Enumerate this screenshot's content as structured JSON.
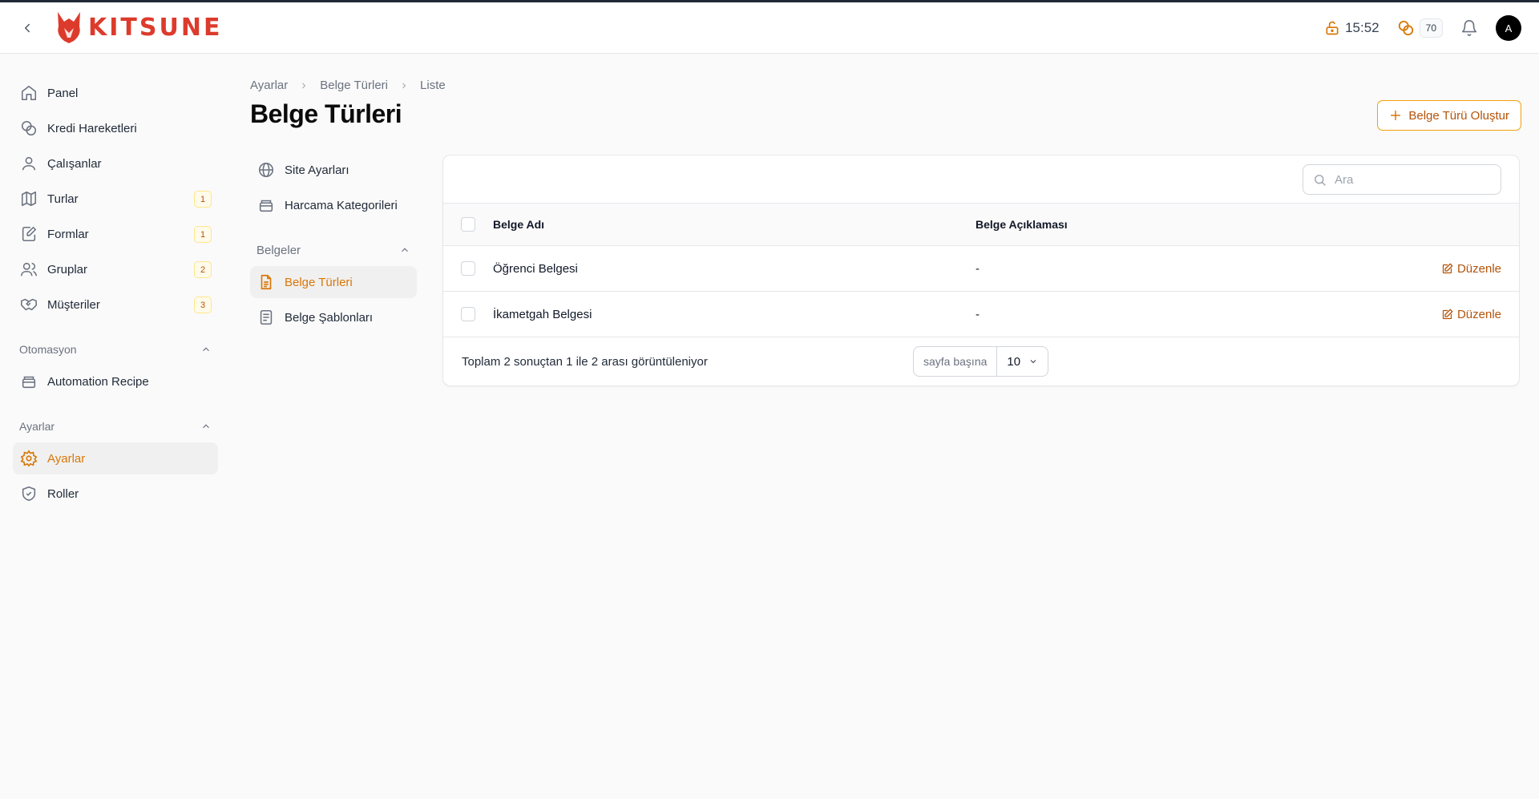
{
  "header": {
    "logo_text": "KITSUNE",
    "time": "15:52",
    "credits": "70",
    "avatar_initial": "A",
    "brand_color": "#dc3b2c",
    "accent_color": "#d97706"
  },
  "sidebar": {
    "items": [
      {
        "label": "Panel",
        "icon": "home-icon"
      },
      {
        "label": "Kredi Hareketleri",
        "icon": "coins-icon"
      },
      {
        "label": "Çalışanlar",
        "icon": "user-icon"
      },
      {
        "label": "Turlar",
        "icon": "map-icon",
        "badge": "1"
      },
      {
        "label": "Formlar",
        "icon": "form-edit-icon",
        "badge": "1"
      },
      {
        "label": "Gruplar",
        "icon": "users-icon",
        "badge": "2"
      },
      {
        "label": "Müşteriler",
        "icon": "handshake-icon",
        "badge": "3"
      }
    ],
    "groups": [
      {
        "label": "Otomasyon",
        "items": [
          {
            "label": "Automation Recipe",
            "icon": "archive-icon"
          }
        ]
      },
      {
        "label": "Ayarlar",
        "items": [
          {
            "label": "Ayarlar",
            "icon": "gear-icon",
            "active": true
          },
          {
            "label": "Roller",
            "icon": "shield-check-icon"
          }
        ]
      }
    ]
  },
  "breadcrumb": [
    "Ayarlar",
    "Belge Türleri",
    "Liste"
  ],
  "page_title": "Belge Türleri",
  "create_button": "Belge Türü Oluştur",
  "subnav": {
    "items": [
      {
        "label": "Site Ayarları",
        "icon": "globe-icon"
      },
      {
        "label": "Harcama Kategorileri",
        "icon": "archive-icon"
      }
    ],
    "group": {
      "label": "Belgeler",
      "items": [
        {
          "label": "Belge Türleri",
          "icon": "document-icon",
          "active": true
        },
        {
          "label": "Belge Şablonları",
          "icon": "template-icon"
        }
      ]
    }
  },
  "table": {
    "search_placeholder": "Ara",
    "columns": [
      "Belge Adı",
      "Belge Açıklaması"
    ],
    "rows": [
      {
        "name": "Öğrenci Belgesi",
        "description": "-",
        "action": "Düzenle"
      },
      {
        "name": "İkametgah Belgesi",
        "description": "-",
        "action": "Düzenle"
      }
    ],
    "footer_text": "Toplam 2 sonuçtan 1 ile 2 arası görüntüleniyor",
    "per_page_label": "sayfa başına",
    "per_page_value": "10"
  }
}
